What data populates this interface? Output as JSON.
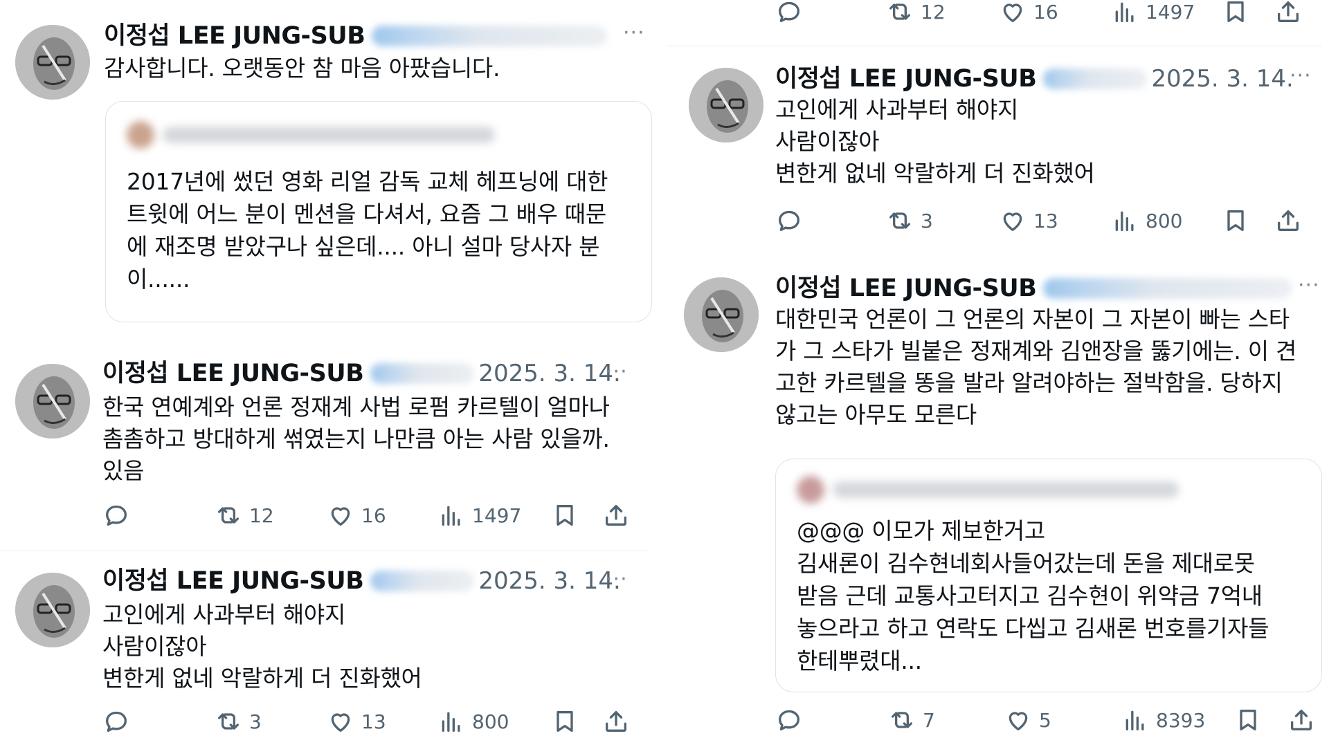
{
  "author": {
    "name": "이정섭 LEE JUNG-SUB"
  },
  "left": {
    "top_tweet": {
      "text": "감사합니다. 오랫동안 참 마음 아팠습니다.",
      "quote": {
        "text": "2017년에 썼던 영화 리얼 감독 교체 헤프닝에 대한\n트윗에 어느 분이 멘션을 다셔서, 요즘 그 배우 때문\n에 재조명 받았구나 싶은데.... 아니 설마 당사자 분\n이......"
      }
    },
    "tweet2": {
      "date": "2025. 3. 14.",
      "text": "한국 연예계와 언론 정재계 사법 로펌 카르텔이 얼마나\n촘촘하고 방대하게 썪였는지 나만큼 아는 사람 있을까.\n있음",
      "actions": {
        "retweets": "12",
        "likes": "16",
        "views": "1497"
      }
    },
    "tweet3": {
      "date": "2025. 3. 14.",
      "text": "고인에게 사과부터 해야지\n사람이잖아\n변한게 없네 악랄하게 더 진화했어",
      "actions": {
        "retweets": "3",
        "likes": "13",
        "views": "800"
      }
    }
  },
  "right": {
    "top_actions": {
      "retweets": "12",
      "likes": "16",
      "views": "1497"
    },
    "tweet1": {
      "date": "2025. 3. 14.",
      "text": "고인에게 사과부터 해야지\n사람이잖아\n변한게 없네 악랄하게 더 진화했어",
      "actions": {
        "retweets": "3",
        "likes": "13",
        "views": "800"
      }
    },
    "tweet2": {
      "text": "대한민국 언론이 그 언론의 자본이 그 자본이 빠는 스타\n가 그 스타가 빌붙은 정재계와 김앤장을 뚫기에는. 이 견\n고한 카르텔을 똥을 발라 알려야하는 절박함을. 당하지\n않고는 아무도 모른다",
      "quote": {
        "text": "@@@ 이모가 제보한거고\n김새론이 김수현네회사들어갔는데 돈을 제대로못\n받음 근데 교통사고터지고 김수현이 위약금 7억내\n놓으라고 하고 연락도 다씹고 김새론 번호를기자들\n한테뿌렸대..."
      },
      "actions": {
        "retweets": "7",
        "likes": "5",
        "views": "8393"
      }
    }
  },
  "icons": [
    "reply-icon",
    "retweet-icon",
    "like-icon",
    "views-icon",
    "bookmark-icon",
    "share-icon",
    "more-icon"
  ]
}
